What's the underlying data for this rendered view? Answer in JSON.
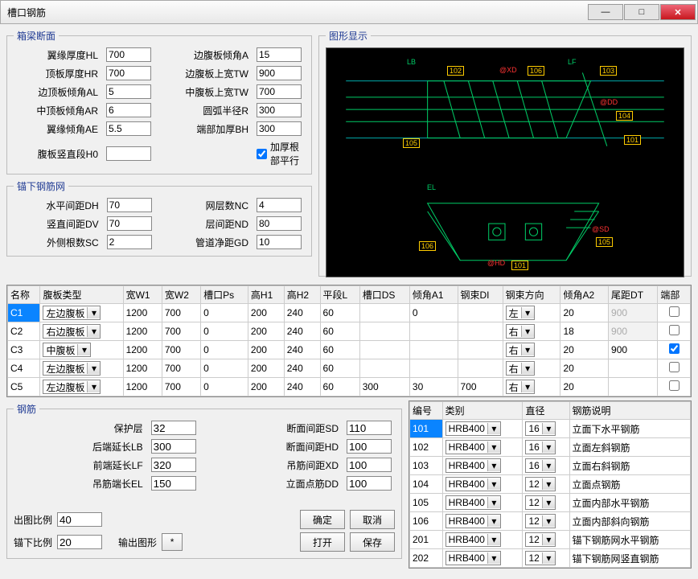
{
  "window": {
    "title": "槽口钢筋"
  },
  "section1": {
    "legend": "箱梁断面",
    "hl_label": "翼缘厚度HL",
    "hl": "700",
    "hr_label": "顶板厚度HR",
    "hr": "700",
    "al_label": "边顶板倾角AL",
    "al": "5",
    "ar_label": "中顶板倾角AR",
    "ar": "6",
    "ae_label": "翼缘倾角AE",
    "ae": "5.5",
    "h0_label": "腹板竖直段H0",
    "h0": "",
    "a_label": "边腹板倾角A",
    "a": "15",
    "tw_label": "边腹板上宽TW",
    "tw": "900",
    "tw2_label": "中腹板上宽TW",
    "tw2": "700",
    "r_label": "圆弧半径R",
    "r": "300",
    "bh_label": "端部加厚BH",
    "bh": "300",
    "chk_label": "加厚根部平行"
  },
  "section2": {
    "legend": "锚下钢筋网",
    "dh_label": "水平间距DH",
    "dh": "70",
    "dv_label": "竖直间距DV",
    "dv": "70",
    "sc_label": "外侧根数SC",
    "sc": "2",
    "nc_label": "网层数NC",
    "nc": "4",
    "nd_label": "层间距ND",
    "nd": "80",
    "gd_label": "管道净距GD",
    "gd": "10"
  },
  "graphic_legend": "图形显示",
  "gtexts": {
    "lb": "LB",
    "lf": "LF",
    "n102": "102",
    "n106": "106",
    "n103": "103",
    "xd": "@XD",
    "dd": "@DD",
    "n104": "104",
    "n105": "105",
    "n101": "101",
    "el": "EL",
    "sd": "@SD",
    "hd": "@HD",
    "n105b": "105",
    "n106b": "106",
    "n101b": "101"
  },
  "grid1": {
    "headers": [
      "名称",
      "腹板类型",
      "宽W1",
      "宽W2",
      "槽口Ps",
      "高H1",
      "高H2",
      "平段L",
      "槽口DS",
      "倾角A1",
      "钢束DI",
      "钢束方向",
      "倾角A2",
      "尾距DT",
      "端部"
    ],
    "rows": [
      {
        "name": "C1",
        "type": "左边腹板",
        "w1": "1200",
        "w2": "700",
        "ps": "0",
        "h1": "200",
        "h2": "240",
        "l": "60",
        "ds": "",
        "a1": "0",
        "di": "",
        "dir": "左",
        "a2": "20",
        "dt": "900",
        "end": false,
        "dtDisabled": true
      },
      {
        "name": "C2",
        "type": "右边腹板",
        "w1": "1200",
        "w2": "700",
        "ps": "0",
        "h1": "200",
        "h2": "240",
        "l": "60",
        "ds": "",
        "a1": "",
        "di": "",
        "dir": "右",
        "a2": "18",
        "dt": "900",
        "end": false,
        "dtDisabled": true
      },
      {
        "name": "C3",
        "type": "中腹板",
        "w1": "1200",
        "w2": "700",
        "ps": "0",
        "h1": "200",
        "h2": "240",
        "l": "60",
        "ds": "",
        "a1": "",
        "di": "",
        "dir": "右",
        "a2": "20",
        "dt": "900",
        "end": true,
        "dtDisabled": false
      },
      {
        "name": "C4",
        "type": "左边腹板",
        "w1": "1200",
        "w2": "700",
        "ps": "0",
        "h1": "200",
        "h2": "240",
        "l": "60",
        "ds": "",
        "a1": "",
        "di": "",
        "dir": "右",
        "a2": "20",
        "dt": "",
        "end": false,
        "dtDisabled": false
      },
      {
        "name": "C5",
        "type": "左边腹板",
        "w1": "1200",
        "w2": "700",
        "ps": "0",
        "h1": "200",
        "h2": "240",
        "l": "60",
        "ds": "300",
        "a1": "30",
        "di": "700",
        "dir": "右",
        "a2": "20",
        "dt": "",
        "end": false,
        "dtDisabled": false
      }
    ]
  },
  "steel_legend": "钢筋",
  "steel": {
    "cover_label": "保护层",
    "cover": "32",
    "lb_label": "后端延长LB",
    "lb": "300",
    "lf_label": "前端延长LF",
    "lf": "320",
    "el_label": "吊筋端长EL",
    "el": "150",
    "sd_label": "断面间距SD",
    "sd": "110",
    "hd_label": "断面间距HD",
    "hd": "100",
    "xd_label": "吊筋间距XD",
    "xd": "100",
    "dd_label": "立面点筋DD",
    "dd": "100"
  },
  "output": {
    "scale_label": "出图比例",
    "scale": "40",
    "anchor_label": "锚下比例",
    "anchor": "20",
    "outshape_label": "输出图形"
  },
  "buttons": {
    "ok": "确定",
    "cancel": "取消",
    "open": "打开",
    "save": "保存",
    "star": "*"
  },
  "grid2": {
    "headers": [
      "编号",
      "类别",
      "直径",
      "钢筋说明"
    ],
    "rows": [
      {
        "id": "101",
        "cls": "HRB400",
        "dia": "16",
        "desc": "立面下水平钢筋",
        "sel": true
      },
      {
        "id": "102",
        "cls": "HRB400",
        "dia": "16",
        "desc": "立面左斜钢筋"
      },
      {
        "id": "103",
        "cls": "HRB400",
        "dia": "16",
        "desc": "立面右斜钢筋"
      },
      {
        "id": "104",
        "cls": "HRB400",
        "dia": "12",
        "desc": "立面点钢筋"
      },
      {
        "id": "105",
        "cls": "HRB400",
        "dia": "12",
        "desc": "立面内部水平钢筋"
      },
      {
        "id": "106",
        "cls": "HRB400",
        "dia": "12",
        "desc": "立面内部斜向钢筋"
      },
      {
        "id": "201",
        "cls": "HRB400",
        "dia": "12",
        "desc": "锚下钢筋网水平钢筋"
      },
      {
        "id": "202",
        "cls": "HRB400",
        "dia": "12",
        "desc": "锚下钢筋网竖直钢筋"
      }
    ]
  }
}
